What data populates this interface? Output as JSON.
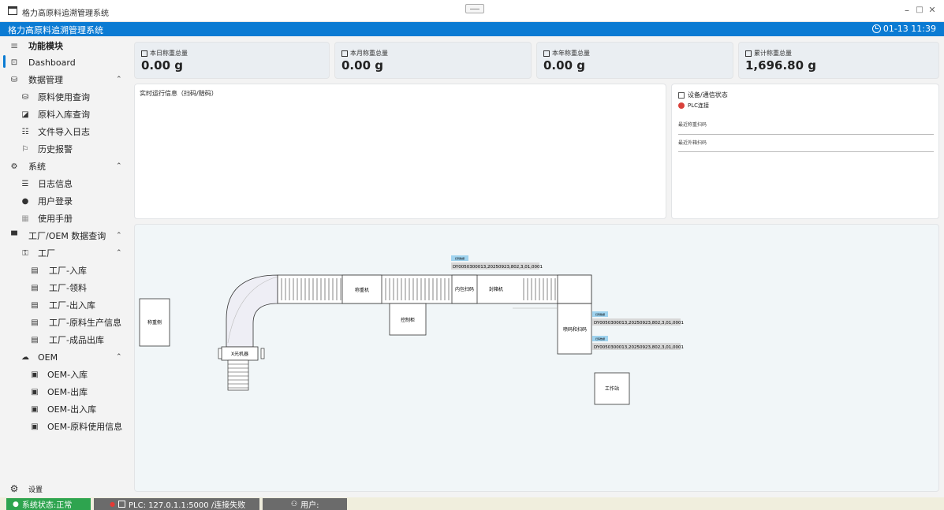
{
  "window": {
    "title": "格力高原料追溯管理系统",
    "min": "–",
    "max": "□",
    "close": "✕"
  },
  "app_bar": {
    "title": "格力高原料追溯管理系统",
    "clock": "01-13 11:39"
  },
  "sidebar": {
    "header": "功能模块",
    "items": [
      {
        "label": "Dashboard",
        "icon": "dashboard-icon"
      },
      {
        "label": "数据管理",
        "icon": "database-icon"
      },
      {
        "label": "原料使用查询",
        "icon": "database-icon"
      },
      {
        "label": "原料入库查询",
        "icon": "image-icon"
      },
      {
        "label": "文件导入日志",
        "icon": "log-icon"
      },
      {
        "label": "历史报警",
        "icon": "alarm-icon"
      },
      {
        "label": "系统",
        "icon": "gear-icon"
      },
      {
        "label": "日志信息",
        "icon": "list-icon"
      },
      {
        "label": "用户登录",
        "icon": "info-icon"
      },
      {
        "label": "使用手册",
        "icon": "book-icon"
      },
      {
        "label": "工厂/OEM 数据查询",
        "icon": "factory-icon"
      },
      {
        "label": "工厂",
        "icon": "factory-icon"
      },
      {
        "label": "工厂-入库",
        "icon": "clipboard-icon"
      },
      {
        "label": "工厂-领料",
        "icon": "clipboard-icon"
      },
      {
        "label": "工厂-出入库",
        "icon": "clipboard-icon"
      },
      {
        "label": "工厂-原料生产信息",
        "icon": "clipboard-icon"
      },
      {
        "label": "工厂-成品出库",
        "icon": "clipboard-icon"
      },
      {
        "label": "OEM",
        "icon": "cloud-icon"
      },
      {
        "label": "OEM-入库",
        "icon": "document-icon"
      },
      {
        "label": "OEM-出库",
        "icon": "document-icon"
      },
      {
        "label": "OEM-出入库",
        "icon": "document-icon"
      },
      {
        "label": "OEM-原料使用信息",
        "icon": "document-icon"
      }
    ],
    "settings": "设置"
  },
  "stats": [
    {
      "label": "本日称重总量",
      "value": "0.00 g"
    },
    {
      "label": "本月称重总量",
      "value": "0.00 g"
    },
    {
      "label": "本年称重总量",
      "value": "0.00 g"
    },
    {
      "label": "累计称重总量",
      "value": "1,696.80 g"
    }
  ],
  "runtime_panel": {
    "title": "实时运行信息（扫码/赔码）"
  },
  "device_panel": {
    "title": "设备/通信状态",
    "plc": "PLC连接",
    "plc_color": "#d9413b",
    "recent_weigh": "最近称重扫码",
    "recent_box": "最近外箱扫码"
  },
  "diagram": {
    "weigh_side": "称重侧",
    "xray": "X光机器",
    "scale": "称重机",
    "control": "控制柜",
    "inner_scan": "内包扫码",
    "sealer": "封箱机",
    "spray_scan": "喷码和扫码",
    "workstation": "工作站",
    "tag": "扫码数据",
    "code_top": "DY0050300013,20250923,802,3,01,0001",
    "code_a": "DY0050300013,20250923,802,3,01,0001",
    "code_b": "DY0050300013,20250923,802,3,01,0001"
  },
  "status_bar": {
    "system": "系统状态:正常",
    "plc": "PLC: 127.0.1.1:5000 /连接失败",
    "user": "用户:",
    "system_color": "#2ea44f",
    "plc_dot_color": "#e53935"
  }
}
